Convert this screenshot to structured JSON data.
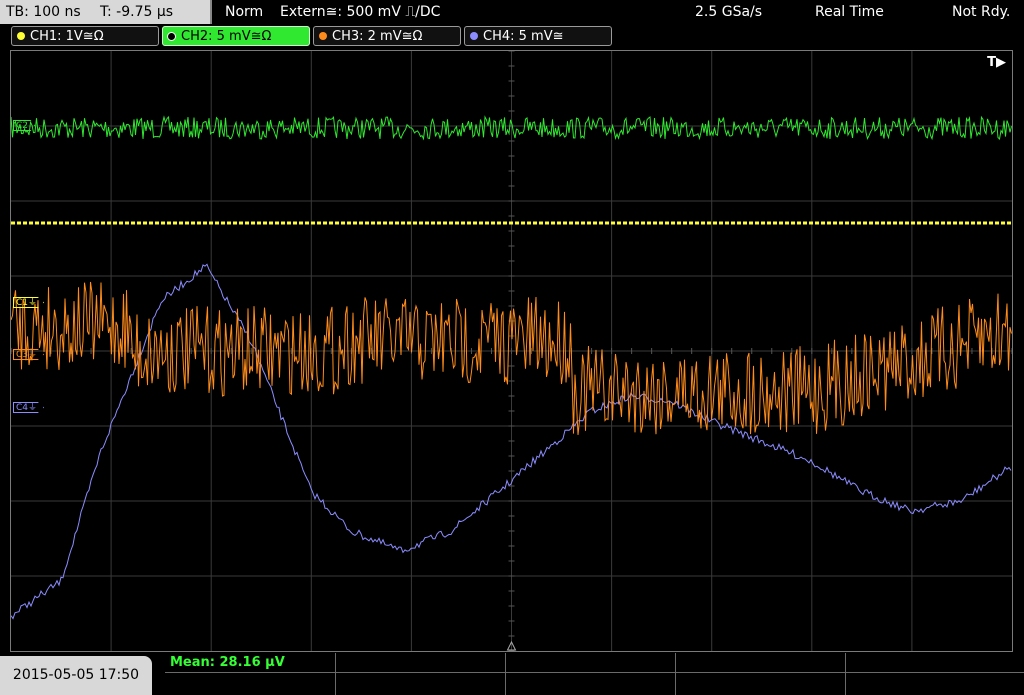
{
  "status": {
    "timebase": "TB: 100 ns",
    "trigger_time": "T: -9.75 µs",
    "mode": "Norm",
    "trigger_source": "Extern≅: 500 mV ⎍/DC",
    "sample_rate": "2.5 GSa/s",
    "acquisition": "Real Time",
    "state": "Not Rdy."
  },
  "channels": [
    {
      "label": "CH1: 1V≅Ω",
      "color": "#ffff33",
      "active": false
    },
    {
      "label": "CH2: 5 mV≅Ω",
      "color": "#2fe82f",
      "active": true
    },
    {
      "label": "CH3: 2 mV≅Ω",
      "color": "#ff8c1a",
      "active": false
    },
    {
      "label": "CH4: 5 mV≅",
      "color": "#8c8cff",
      "active": false
    }
  ],
  "markers": {
    "trigger": "T▶",
    "c2": "C2",
    "c1": "C1⏚",
    "c3": "C3⏚",
    "c4": "C4⏚"
  },
  "measurement": {
    "label": "Mean: 28.16 µV"
  },
  "footer": {
    "datetime": "2015-05-05 17:50"
  },
  "colors": {
    "ch1": "#ffff33",
    "ch2": "#2fe82f",
    "ch3": "#ff8c1a",
    "ch4": "#8c8cff",
    "grid": "#3a3a3a"
  }
}
